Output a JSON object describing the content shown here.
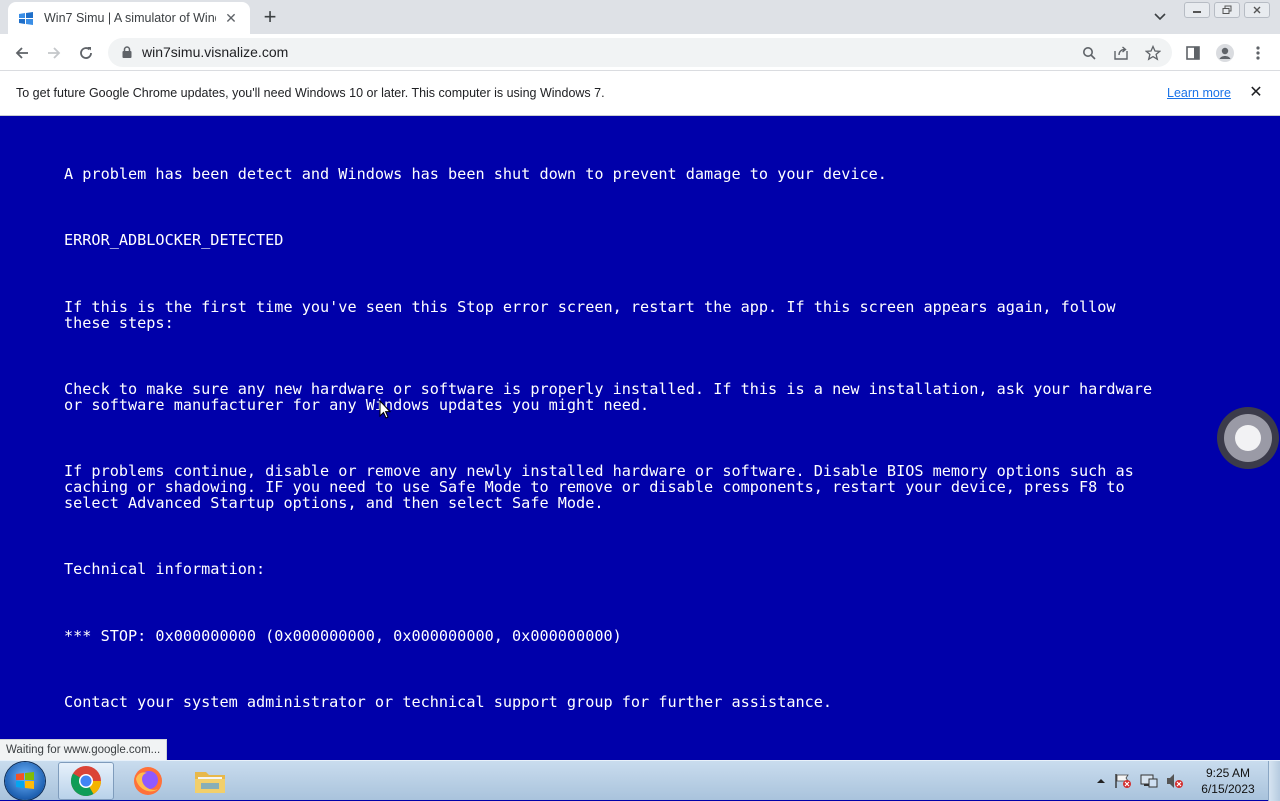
{
  "browser": {
    "tab": {
      "title": "Win7 Simu | A simulator of Windows 7",
      "close": "✕"
    },
    "new_tab": "+",
    "url": "win7simu.visnalize.com",
    "status_text": "Waiting for www.google.com..."
  },
  "infobar": {
    "message": "To get future Google Chrome updates, you'll need Windows 10 or later. This computer is using Windows 7.",
    "link": "Learn more",
    "close": "✕"
  },
  "bsod": {
    "line1": "A problem has been detect and Windows has been shut down to prevent damage to your device.",
    "error_code": "ERROR_ADBLOCKER_DETECTED",
    "para1": "If this is the first time you've seen this Stop error screen, restart the app. If this screen appears again, follow\nthese steps:",
    "para2": "Check to make sure any new hardware or software is properly installed. If this is a new installation, ask your hardware\nor software manufacturer for any Windows updates you might need.",
    "para3": "If problems continue, disable or remove any newly installed hardware or software. Disable BIOS memory options such as\ncaching or shadowing. IF you need to use Safe Mode to remove or disable components, restart your device, press F8 to\nselect Advanced Startup options, and then select Safe Mode.",
    "tech_heading": "Technical information:",
    "stop_line": "*** STOP: 0x000000000 (0x000000000, 0x000000000, 0x000000000)",
    "contact": "Contact your system administrator or technical support group for further assistance."
  },
  "taskbar": {
    "time": "9:25 AM",
    "date": "6/15/2023",
    "pinned": [
      "chrome-icon",
      "firefox-icon",
      "folder-icon"
    ]
  },
  "colors": {
    "bsod_blue": "#0000aa",
    "chrome_tabstrip": "#dee1e6",
    "link_blue": "#1a73e8"
  }
}
